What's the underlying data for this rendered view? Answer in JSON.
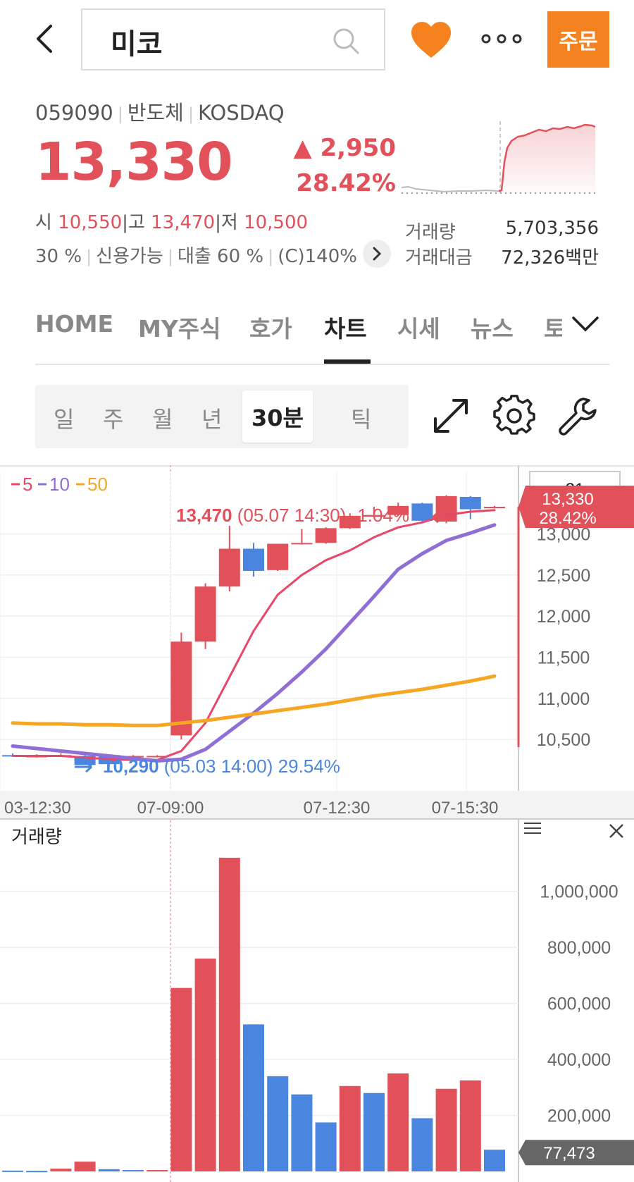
{
  "header": {
    "stock_name": "미코",
    "order_label": "주문"
  },
  "stock": {
    "code": "059090",
    "sector": "반도체",
    "market": "KOSDAQ",
    "price": "13,330",
    "change": "▲ 2,950",
    "change_pct": "28.42%",
    "open_label": "시",
    "open": "10,550",
    "high_label": "고",
    "high": "13,470",
    "low_label": "저",
    "low": "10,500",
    "sub_info": [
      "30 %",
      "신용가능",
      "대출 60 %",
      "(C)140%"
    ],
    "volume_label": "거래량",
    "volume": "5,703,356",
    "amount_label": "거래대금",
    "amount": "72,326백만"
  },
  "tabs": [
    {
      "label": "HOME",
      "active": false
    },
    {
      "label": "MY주식",
      "active": false
    },
    {
      "label": "호가",
      "active": false
    },
    {
      "label": "차트",
      "active": true
    },
    {
      "label": "시세",
      "active": false
    },
    {
      "label": "뉴스",
      "active": false
    },
    {
      "label": "토",
      "active": false
    }
  ],
  "periods": [
    {
      "label": "일",
      "active": false
    },
    {
      "label": "주",
      "active": false
    },
    {
      "label": "월",
      "active": false
    },
    {
      "label": "년",
      "active": false
    },
    {
      "label": "30분",
      "active": true
    },
    {
      "label": "틱",
      "active": false
    }
  ],
  "colors": {
    "up": "#e2505a",
    "down": "#4a86e0",
    "ma5": "#e8476a",
    "ma10": "#8f6fd6",
    "ma50": "#f5a623",
    "accent": "#f58220"
  },
  "chart_data": [
    {
      "type": "candlestick",
      "legend": [
        "5",
        "10",
        "50"
      ],
      "x_ticks": [
        "03-12:30",
        "07-09:00",
        "07-12:30",
        "07-15:30"
      ],
      "y_ticks": [
        10500,
        11000,
        11500,
        12000,
        12500,
        13000
      ],
      "ylim": [
        10150,
        13750
      ],
      "candles": [
        {
          "o": 10310,
          "h": 10330,
          "l": 10290,
          "c": 10300
        },
        {
          "o": 10300,
          "h": 10320,
          "l": 10280,
          "c": 10300
        },
        {
          "o": 10300,
          "h": 10330,
          "l": 10290,
          "c": 10310
        },
        {
          "o": 10300,
          "h": 10320,
          "l": 10200,
          "c": 10190
        },
        {
          "o": 10310,
          "h": 10320,
          "l": 10180,
          "c": 10200
        },
        {
          "o": 10300,
          "h": 10310,
          "l": 10290,
          "c": 10300
        },
        {
          "o": 10300,
          "h": 10310,
          "l": 10290,
          "c": 10300
        },
        {
          "o": 10550,
          "h": 11800,
          "l": 10500,
          "c": 11690
        },
        {
          "o": 11690,
          "h": 12400,
          "l": 11600,
          "c": 12360
        },
        {
          "o": 12360,
          "h": 13100,
          "l": 12300,
          "c": 12820
        },
        {
          "o": 12820,
          "h": 12890,
          "l": 12480,
          "c": 12550
        },
        {
          "o": 12560,
          "h": 12880,
          "l": 12550,
          "c": 12880
        },
        {
          "o": 12880,
          "h": 13060,
          "l": 12870,
          "c": 12890
        },
        {
          "o": 12890,
          "h": 13080,
          "l": 12880,
          "c": 13070
        },
        {
          "o": 13070,
          "h": 13250,
          "l": 13060,
          "c": 13220
        },
        {
          "o": 13210,
          "h": 13330,
          "l": 13200,
          "c": 13230
        },
        {
          "o": 13230,
          "h": 13380,
          "l": 13220,
          "c": 13340
        },
        {
          "o": 13370,
          "h": 13380,
          "l": 13150,
          "c": 13160
        },
        {
          "o": 13150,
          "h": 13470,
          "l": 13130,
          "c": 13460
        },
        {
          "o": 13450,
          "h": 13460,
          "l": 13180,
          "c": 13300
        },
        {
          "o": 13330,
          "h": 13340,
          "l": 13310,
          "c": 13330
        }
      ],
      "ma": [
        {
          "name": "5",
          "values": [
            10300,
            10300,
            10300,
            10280,
            10260,
            10250,
            10250,
            10360,
            10700,
            11260,
            11820,
            12260,
            12500,
            12680,
            12800,
            12960,
            13080,
            13140,
            13230,
            13270,
            13290
          ]
        },
        {
          "name": "10",
          "values": [
            10420,
            10390,
            10360,
            10330,
            10300,
            10270,
            10240,
            10260,
            10380,
            10600,
            10820,
            11060,
            11320,
            11600,
            11920,
            12240,
            12570,
            12760,
            12920,
            13010,
            13110
          ]
        },
        {
          "name": "50",
          "values": [
            10700,
            10690,
            10690,
            10680,
            10680,
            10670,
            10670,
            10700,
            10730,
            10770,
            10810,
            10850,
            10890,
            10930,
            10980,
            11030,
            11070,
            11110,
            11160,
            11210,
            11270
          ]
        }
      ],
      "annotations": {
        "high": {
          "value": "13,470",
          "text": "(05.07 14:30) -1.04%"
        },
        "low": {
          "value": "10,290",
          "text": "(05.03 14:00) 29.54%"
        }
      },
      "current_price": "13,330",
      "current_pct": "28.42%",
      "count_box": "21"
    },
    {
      "type": "bar",
      "title": "거래량",
      "y_ticks": [
        200000,
        400000,
        600000,
        800000,
        1000000
      ],
      "ylim": [
        0,
        1150000
      ],
      "values": [
        3000,
        2000,
        10000,
        35000,
        8000,
        5000,
        5000,
        655000,
        760000,
        1120000,
        525000,
        340000,
        275000,
        175000,
        305000,
        280000,
        350000,
        190000,
        295000,
        325000,
        77473
      ],
      "directions": [
        "down",
        "down",
        "up",
        "up",
        "down",
        "down",
        "up",
        "up",
        "up",
        "up",
        "down",
        "down",
        "down",
        "down",
        "up",
        "down",
        "up",
        "down",
        "up",
        "up",
        "down"
      ],
      "last_volume": "77,473"
    }
  ]
}
